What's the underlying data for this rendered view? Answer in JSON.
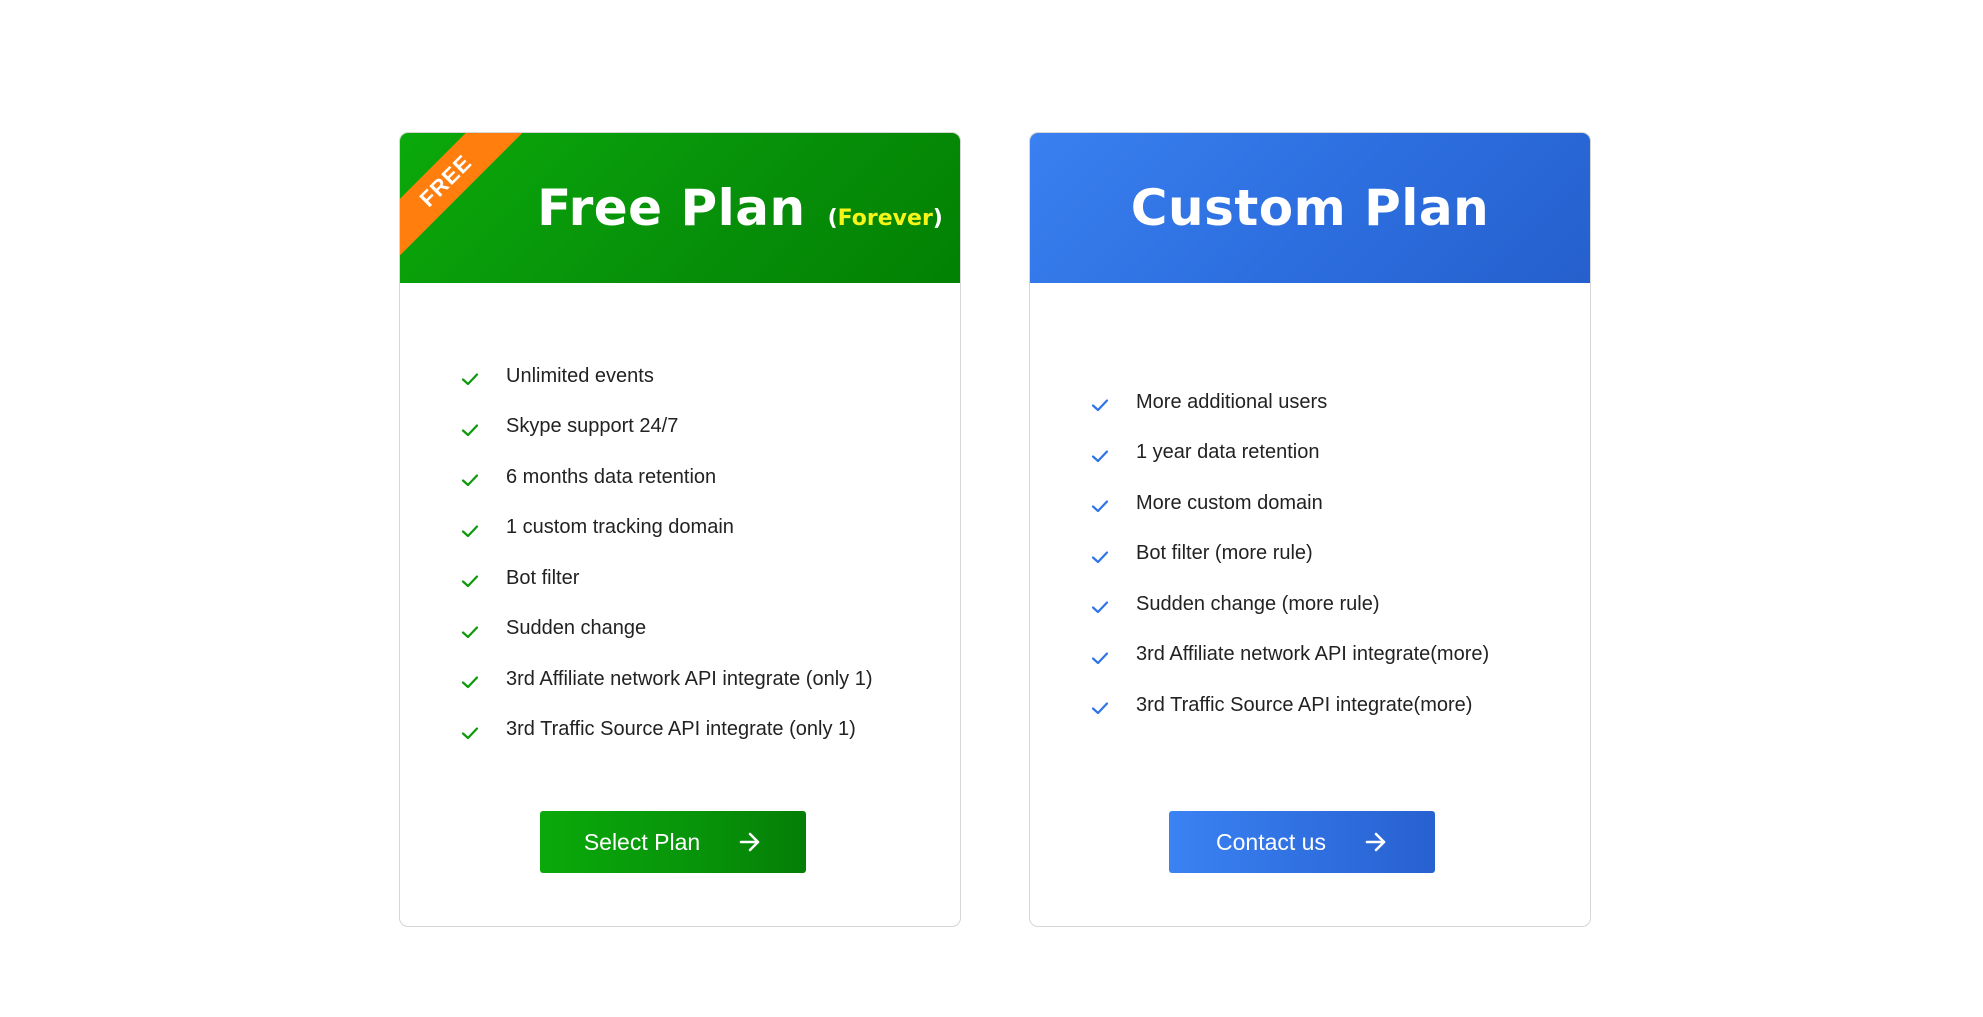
{
  "plans": {
    "free": {
      "ribbon": "FREE",
      "title": "Free Plan",
      "subtitle_open": "(",
      "subtitle_highlight": "Forever",
      "subtitle_close": ")",
      "features": [
        "Unlimited events",
        "Skype support 24/7",
        "6 months data retention",
        "1 custom tracking domain",
        "Bot filter",
        "Sudden change",
        "3rd Affiliate network API integrate (only 1)",
        "3rd Traffic Source API integrate (only 1)"
      ],
      "button_label": "Select Plan",
      "accent_color": "#08990a"
    },
    "custom": {
      "title": "Custom Plan",
      "features": [
        "More additional users",
        "1 year data retention",
        "More custom domain",
        "Bot filter (more rule)",
        "Sudden change (more rule)",
        "3rd Affiliate network API integrate(more)",
        "3rd Traffic Source API integrate(more)"
      ],
      "button_label": "Contact us",
      "accent_color": "#2f6fe0"
    }
  },
  "icons": {
    "check": "check-icon",
    "arrow": "arrow-right-icon"
  },
  "colors": {
    "ribbon": "#ff7e0e",
    "forever_highlight": "#f6f51a",
    "free_check": "#0a9a0a",
    "custom_check": "#2f74e6"
  }
}
